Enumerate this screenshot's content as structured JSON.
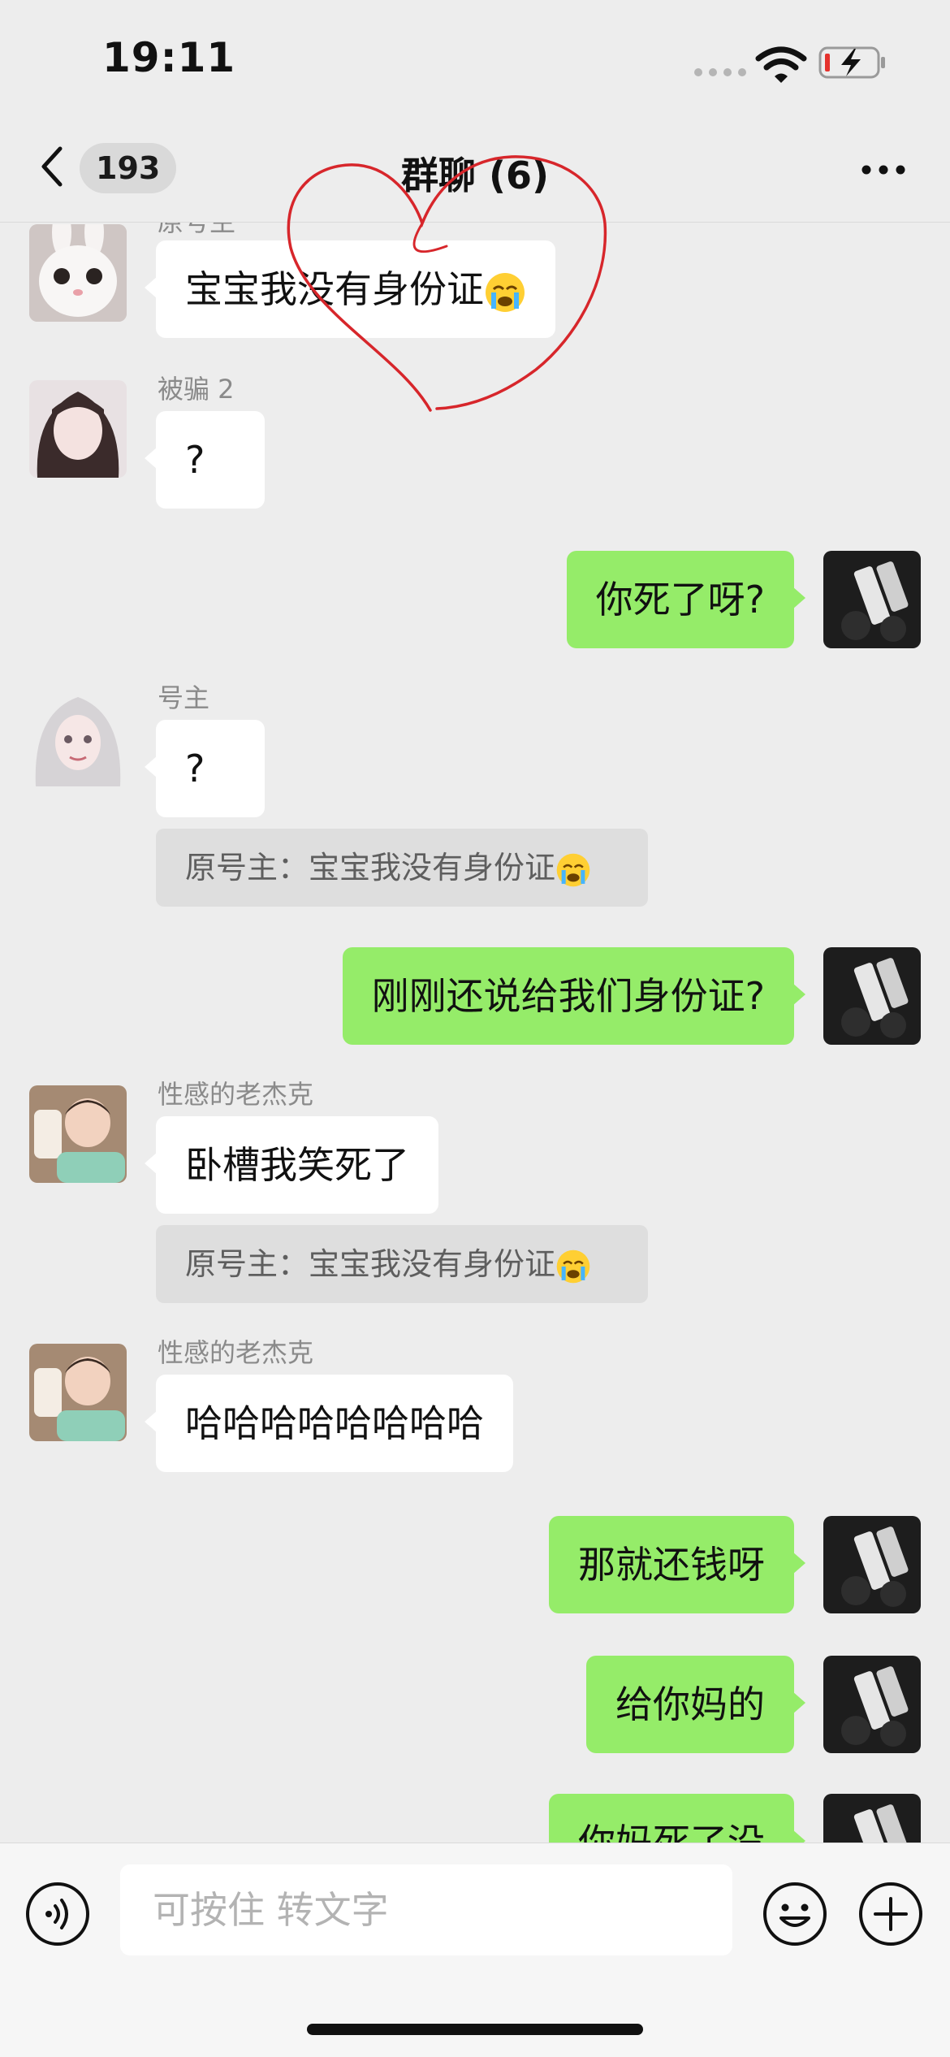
{
  "status_bar": {
    "time": "19:11"
  },
  "nav": {
    "unread_count": "193",
    "title": "群聊 (6)"
  },
  "messages": [
    {
      "sender": "原号主",
      "text": "宝宝我没有身份证",
      "emoji": "crying-emoji"
    },
    {
      "sender": "被骗 2",
      "text": "?"
    },
    {
      "text": "你死了呀?"
    },
    {
      "sender": "号主",
      "text": "?",
      "quote": "原号主：宝宝我没有身份证"
    },
    {
      "text": "刚刚还说给我们身份证?"
    },
    {
      "sender": "性感的老杰克",
      "text": "卧槽我笑死了",
      "quote": "原号主：宝宝我没有身份证"
    },
    {
      "sender": "性感的老杰克",
      "text": "哈哈哈哈哈哈哈哈"
    },
    {
      "text": "那就还钱呀"
    },
    {
      "text": "给你妈的"
    },
    {
      "text": "你妈死了没"
    }
  ],
  "input": {
    "placeholder": "可按住 转文字"
  },
  "colors": {
    "outgoing_bubble": "#95ec69",
    "incoming_bubble": "#ffffff",
    "background": "#ededed",
    "doodle": "#d7262b"
  }
}
